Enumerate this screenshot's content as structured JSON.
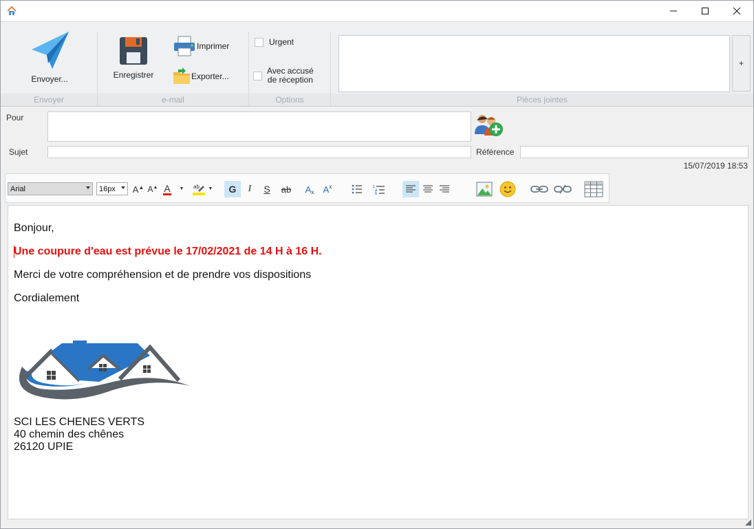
{
  "window": {
    "icon": "home-icon",
    "controls": [
      "minimize-icon",
      "maximize-icon",
      "close-icon"
    ]
  },
  "ribbon": {
    "send": {
      "label": "Envoyer...",
      "group": "Envoyer",
      "icon": "paper-plane-icon"
    },
    "save": {
      "label": "Enregistrer",
      "icon": "floppy-disk-icon"
    },
    "print": {
      "label": "Imprimer",
      "icon": "printer-icon"
    },
    "export": {
      "label": "Exporter...",
      "icon": "export-folder-icon"
    },
    "email_group": "e-mail",
    "urgent": {
      "label": "Urgent",
      "checked": false
    },
    "receipt": {
      "label": "Avec accusé\nde réception",
      "checked": false
    },
    "options_group": "Options",
    "attachments_group": "Pièces jointes",
    "add_attachment": "+"
  },
  "header": {
    "to_label": "Pour",
    "to_value": "",
    "subject_label": "Sujet",
    "subject_value": "",
    "reference_label": "Référence",
    "reference_value": "",
    "date": "15/07/2019 18:53"
  },
  "toolbar": {
    "font": "Arial",
    "size": "16px",
    "bold": "G",
    "italic": "I",
    "underline": "S",
    "strike": "ab",
    "subscript": "A",
    "superscript": "A",
    "grow": "A",
    "shrink": "A",
    "fontcolor": "A"
  },
  "body": {
    "greeting": "Bonjour,",
    "notice": "Une coupure d'eau est prévue le 17/02/2021 de 14 H à 16 H.",
    "thanks": "Merci de votre compréhension et de prendre vos dispositions",
    "closing": "Cordialement",
    "signature": {
      "company": "SCI LES CHENES VERTS",
      "street": "40 chemin des chênes",
      "city": "26120 UPIE"
    },
    "colors": {
      "notice": "#e81010",
      "logo_blue": "#2a76c4",
      "logo_gray": "#5b6168"
    }
  }
}
